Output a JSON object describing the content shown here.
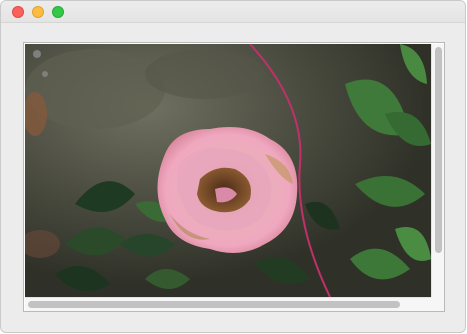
{
  "window": {
    "controls": {
      "close": {
        "icon": "close-dot-icon",
        "color": "#fc605c"
      },
      "minimize": {
        "icon": "minimize-dot-icon",
        "color": "#fdbc40"
      },
      "maximize": {
        "icon": "zoom-dot-icon",
        "color": "#34c84a"
      }
    }
  },
  "image": {
    "subject": "pink-rose-photo",
    "overlay_curve_color": "#c0306a"
  },
  "scrollbars": {
    "vertical": {
      "position": 0.0,
      "visible_fraction": 0.85
    },
    "horizontal": {
      "position": 0.0,
      "visible_fraction": 0.95
    }
  }
}
